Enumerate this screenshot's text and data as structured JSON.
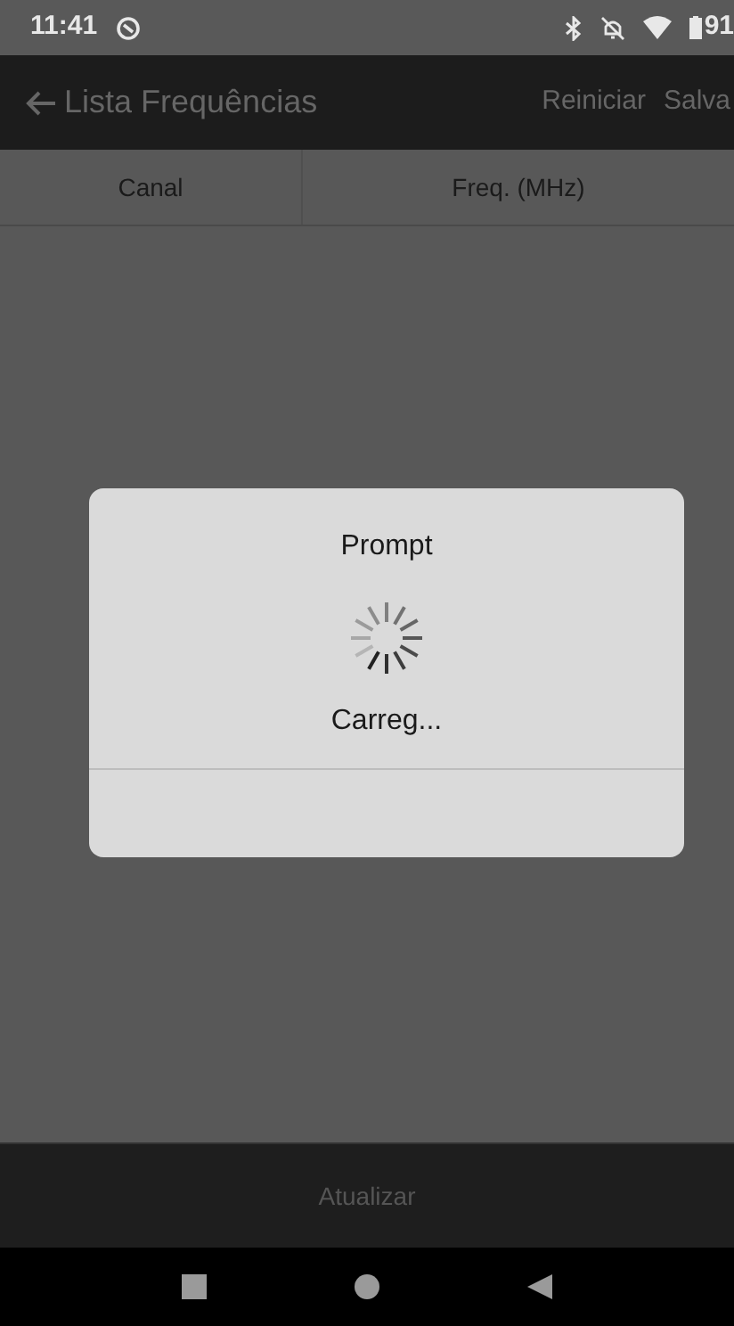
{
  "status_bar": {
    "time": "11:41",
    "battery": "91"
  },
  "app_bar": {
    "title": "Lista Frequências",
    "actions": [
      "Reiniciar",
      "Salva"
    ]
  },
  "table": {
    "columns": [
      "Canal",
      "Freq. (MHz)"
    ]
  },
  "dialog": {
    "title": "Prompt",
    "message": "Carreg..."
  },
  "bottom_button": "Atualizar"
}
